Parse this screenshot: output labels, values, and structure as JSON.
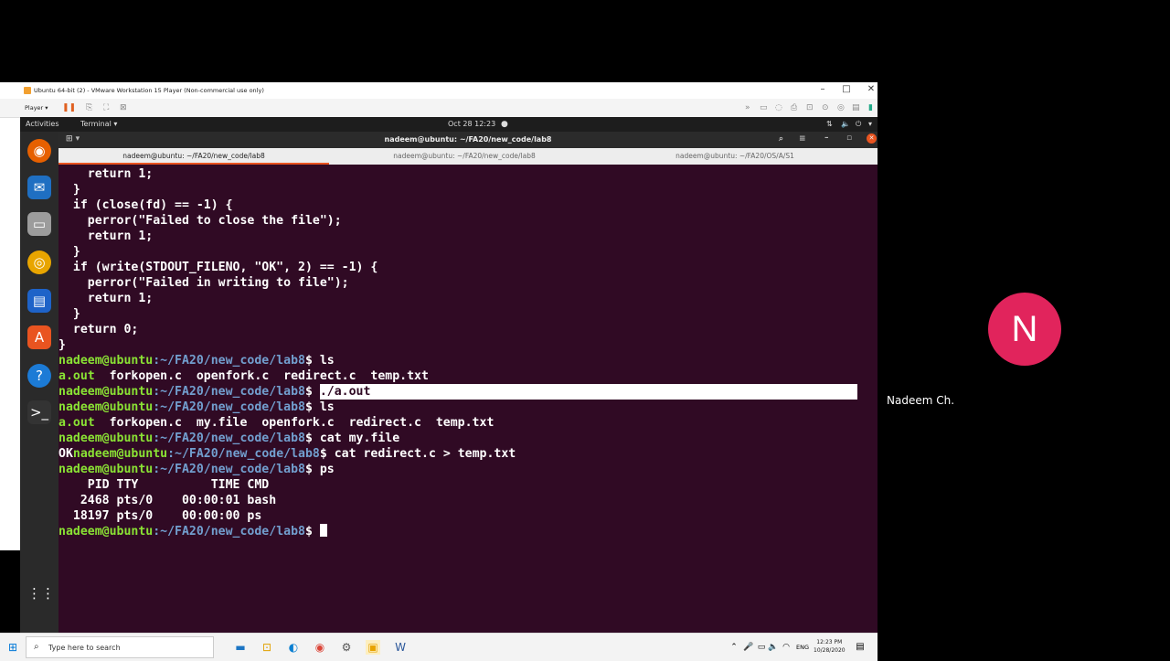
{
  "vm": {
    "title": "Ubuntu 64-bit (2) - VMware Workstation 15 Player (Non-commercial use only)",
    "player_label": "Player ▾"
  },
  "ubuntu_bar": {
    "activities": "Activities",
    "app": "Terminal ▾",
    "datetime": "Oct 28  12:23"
  },
  "terminal": {
    "window_title": "nadeem@ubuntu: ~/FA20/new_code/lab8",
    "tabs": [
      {
        "label": "nadeem@ubuntu: ~/FA20/new_code/lab8"
      },
      {
        "label": "nadeem@ubuntu: ~/FA20/new_code/lab8"
      },
      {
        "label": "nadeem@ubuntu: ~/FA20/OS/A/S1"
      }
    ],
    "prompt_user": "nadeem@ubuntu",
    "prompt_path": ":~/FA20/new_code/lab8",
    "prompt_end": "$ ",
    "code": [
      "    return 1;",
      "  }",
      "  if (close(fd) == -1) {",
      "    perror(\"Failed to close the file\");",
      "    return 1;",
      "  }",
      "  if (write(STDOUT_FILENO, \"OK\", 2) == -1) {",
      "    perror(\"Failed in writing to file\");",
      "    return 1;",
      "  }",
      "  return 0;",
      "}"
    ],
    "cmd_ls1": "ls",
    "out_ls1_green": "a.out",
    "out_ls1_rest": "  forkopen.c  openfork.c  redirect.c  temp.txt",
    "cmd_run": "./a.out",
    "cmd_ls2": "ls",
    "out_ls2_green": "a.out",
    "out_ls2_rest": "  forkopen.c  my.file  openfork.c  redirect.c  temp.txt",
    "cmd_cat": "cat my.file",
    "out_ok": "OK",
    "cmd_cat2": "cat redirect.c > temp.txt",
    "cmd_ps": "ps",
    "ps_header": "    PID TTY          TIME CMD",
    "ps_row1": "   2468 pts/0    00:00:01 bash",
    "ps_row2": "  18197 pts/0    00:00:00 ps"
  },
  "taskbar": {
    "search_placeholder": "Type here to search",
    "time": "12:23 PM",
    "date": "10/28/2020",
    "lang": "ENG"
  },
  "participant": {
    "initial": "N",
    "name": "Nadeem Ch.",
    "avatar_color": "#e1245c"
  }
}
